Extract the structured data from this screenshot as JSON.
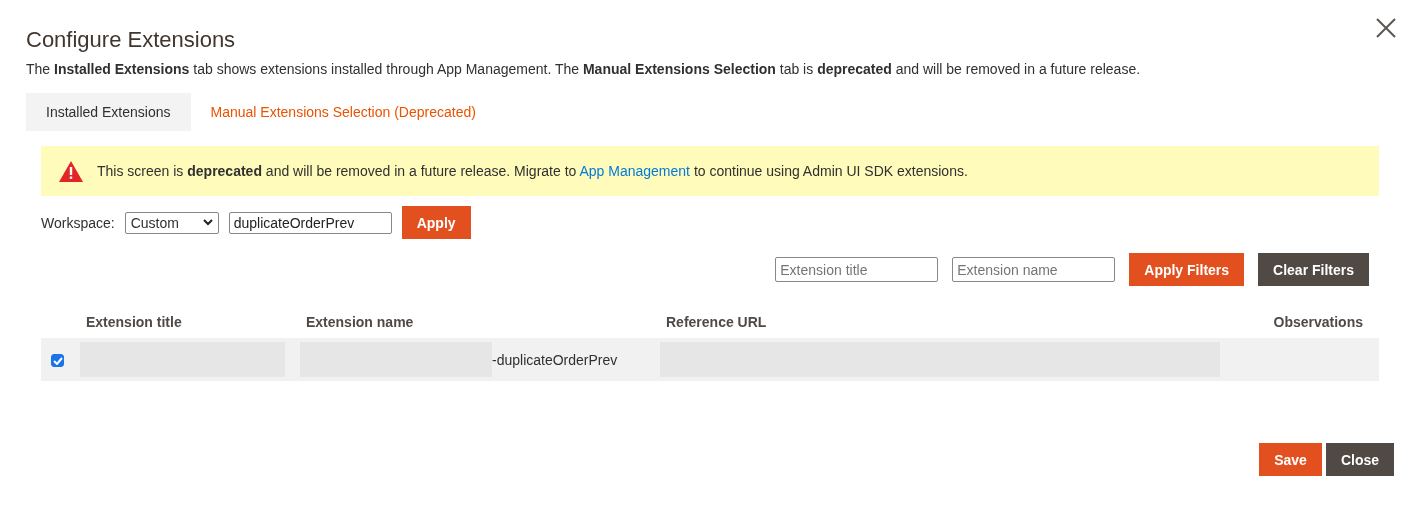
{
  "title": "Configure Extensions",
  "description": "The **Installed Extensions** tab shows extensions installed through App Management. The **Manual Extensions Selection** tab is **deprecated** and will be removed in a future release.",
  "tabs": [
    {
      "label": "Installed Extensions",
      "selected": false
    },
    {
      "label": "Manual Extensions Selection (Deprecated)",
      "selected": true
    }
  ],
  "banner": {
    "text_before": "This screen is **deprecated** and will be removed in a future release. Migrate to",
    "link": "App Management",
    "text_after": "to continue using Admin UI SDK extensions."
  },
  "workspace": {
    "label": "Workspace:",
    "select": "Custom",
    "value": "duplicateOrderPrev",
    "apply": "Apply"
  },
  "filters": {
    "title_placeholder": "Extension title",
    "name_placeholder": "Extension name",
    "apply": "Apply Filters",
    "clear": "Clear Filters"
  },
  "table": {
    "columns": [
      "Extension title",
      "Extension name",
      "Reference URL",
      "Observations"
    ],
    "rows": [
      {
        "checked": true,
        "cells": [
          {
            "redacted": true
          },
          {
            "redacted": true,
            "text": "-duplicateOrderPrev"
          },
          {
            "redacted": true
          }
        ]
      }
    ]
  },
  "footer": {
    "save": "Save",
    "close": "Close"
  }
}
